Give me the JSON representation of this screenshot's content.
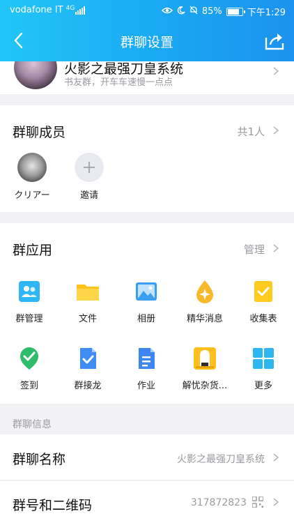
{
  "status": {
    "carrier": "vodafone IT",
    "net": "4G",
    "battery": "85%",
    "time": "下午1:29",
    "battery_level": 0.85
  },
  "header": {
    "title": "群聊设置"
  },
  "group": {
    "name": "火影之最强刀皇系统",
    "desc": "书友群，开车车速慢一点点"
  },
  "members": {
    "title": "群聊成员",
    "count": "共1人",
    "items": [
      {
        "name": "クリアー"
      }
    ],
    "invite_label": "邀请"
  },
  "apps": {
    "title": "群应用",
    "manage_label": "管理",
    "items": [
      {
        "label": "群管理",
        "icon": "group-manage-icon",
        "color": "#2fb7f5"
      },
      {
        "label": "文件",
        "icon": "folder-icon",
        "color": "#ffc21a"
      },
      {
        "label": "相册",
        "icon": "album-icon",
        "color": "#3a9ff2"
      },
      {
        "label": "精华消息",
        "icon": "highlight-icon",
        "color": "#f7b928"
      },
      {
        "label": "收集表",
        "icon": "collect-form-icon",
        "color": "#ffcb1f"
      },
      {
        "label": "签到",
        "icon": "checkin-icon",
        "color": "#2ebd6a"
      },
      {
        "label": "群接龙",
        "icon": "solitaire-icon",
        "color": "#3f8cf5"
      },
      {
        "label": "作业",
        "icon": "homework-icon",
        "color": "#3e86f2"
      },
      {
        "label": "解忧杂货...",
        "icon": "grocery-icon",
        "color": "#ffbf1c"
      },
      {
        "label": "更多",
        "icon": "more-icon",
        "color": "#2db6f2"
      }
    ]
  },
  "info": {
    "header": "群聊信息",
    "name_label": "群聊名称",
    "name_value": "火影之最强刀皇系统",
    "id_label": "群号和二维码",
    "id_value": "317872823"
  }
}
